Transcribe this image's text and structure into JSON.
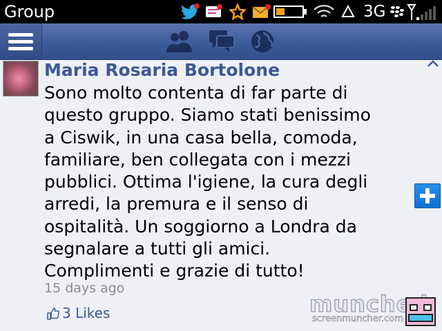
{
  "status_bar": {
    "title": "Group",
    "network": "3G"
  },
  "nav": {
    "icons": [
      "menu-icon",
      "friends-icon",
      "messages-icon",
      "globe-icon"
    ]
  },
  "post": {
    "author": "Maria Rosaria Bortolone",
    "lines": [
      "Sono molto contenta di far parte di",
      "questo gruppo. Siamo stati benissimo",
      "a Ciswik, in una casa bella, comoda,",
      "familiare, ben collegata con i mezzi",
      "pubblici. Ottima l'igiene, la cura degli",
      "arredi, la premura e il senso di",
      "ospitalità. Un soggiorno a Londra da",
      "segnalare a tutti gli amici.",
      "Complimenti e grazie di tutto!"
    ],
    "timestamp": "15 days ago",
    "likes": "3 Likes"
  },
  "watermark": {
    "logo": "munched",
    "url": "screenmuncher.com"
  },
  "colors": {
    "fb_blue": "#3b5998",
    "add_button": "#1a7fe0",
    "page_bg": "#eef0f6"
  }
}
